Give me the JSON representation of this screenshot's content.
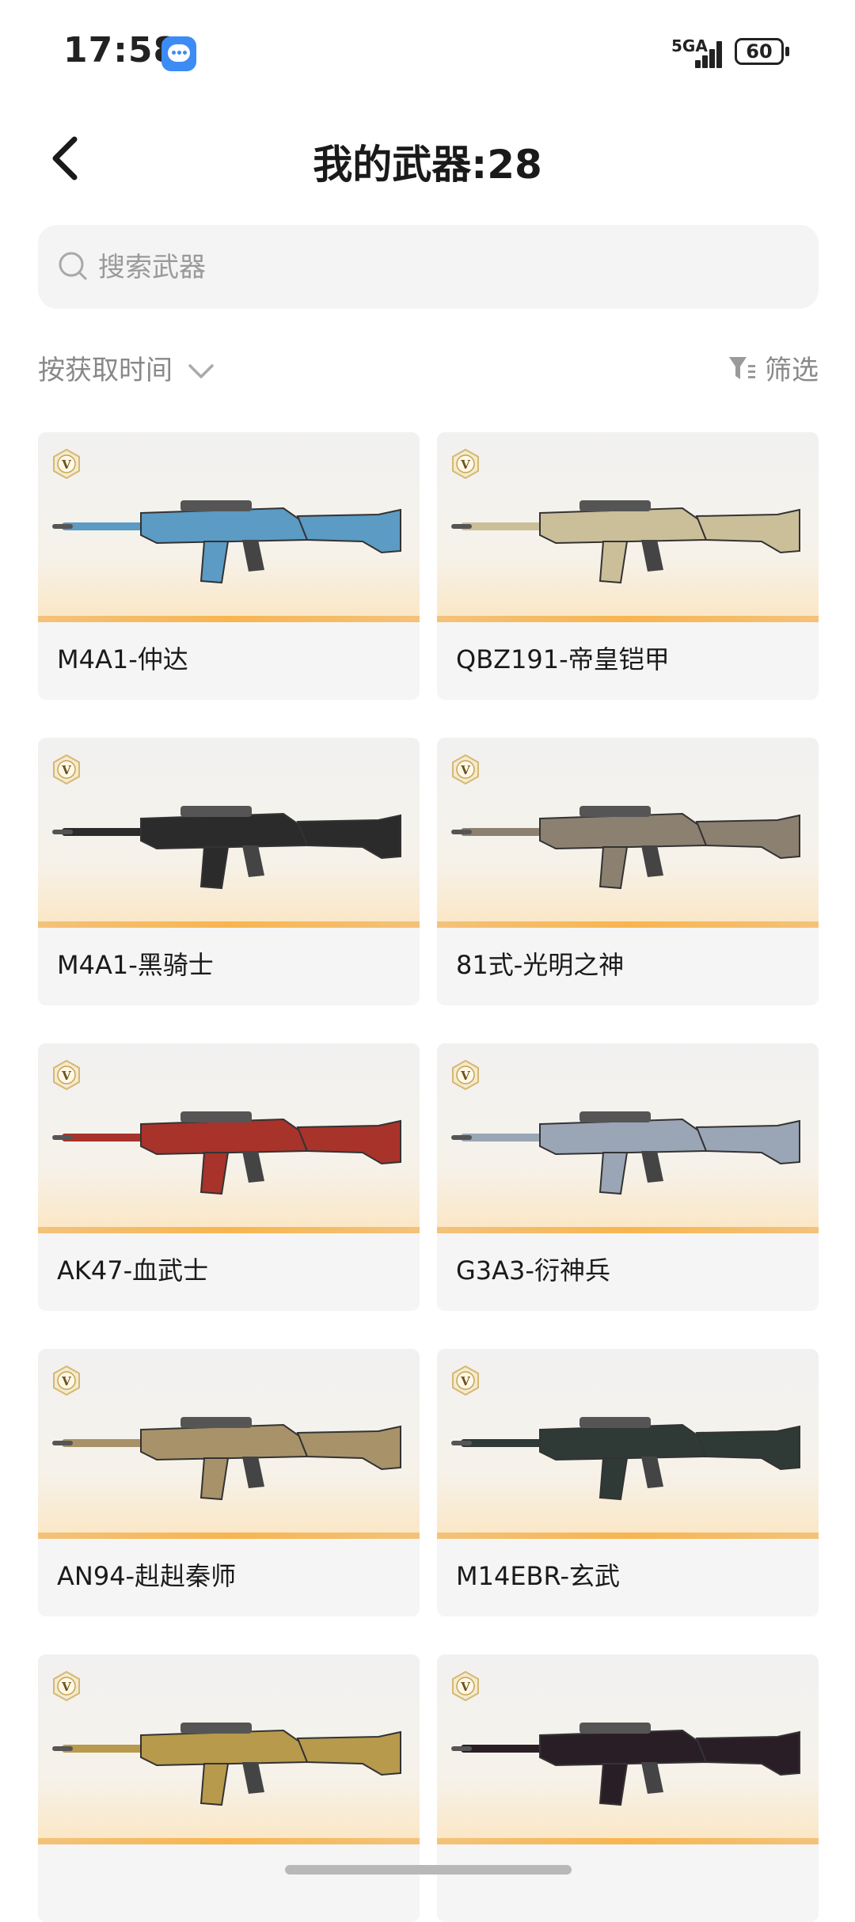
{
  "status_bar": {
    "time": "17:58",
    "network": "5GA",
    "battery": "60"
  },
  "header": {
    "title": "我的武器:28"
  },
  "search": {
    "placeholder": "搜索武器"
  },
  "sort": {
    "label": "按获取时间"
  },
  "filter": {
    "label": "筛选"
  },
  "weapons": [
    {
      "name": "M4A1-仲达",
      "palette": "#5b9bc4"
    },
    {
      "name": "QBZ191-帝皇铠甲",
      "palette": "#cbbf9a"
    },
    {
      "name": "M4A1-黑骑士",
      "palette": "#2b2b2b"
    },
    {
      "name": "81式-光明之神",
      "palette": "#8c8070"
    },
    {
      "name": "AK47-血武士",
      "palette": "#a8332a"
    },
    {
      "name": "G3A3-衍神兵",
      "palette": "#9aa6b6"
    },
    {
      "name": "AN94-赳赳秦师",
      "palette": "#a8926a"
    },
    {
      "name": "M14EBR-玄武",
      "palette": "#2f3a36"
    },
    {
      "name": "",
      "palette": "#b89a4c"
    },
    {
      "name": "",
      "palette": "#2a1e26"
    }
  ]
}
